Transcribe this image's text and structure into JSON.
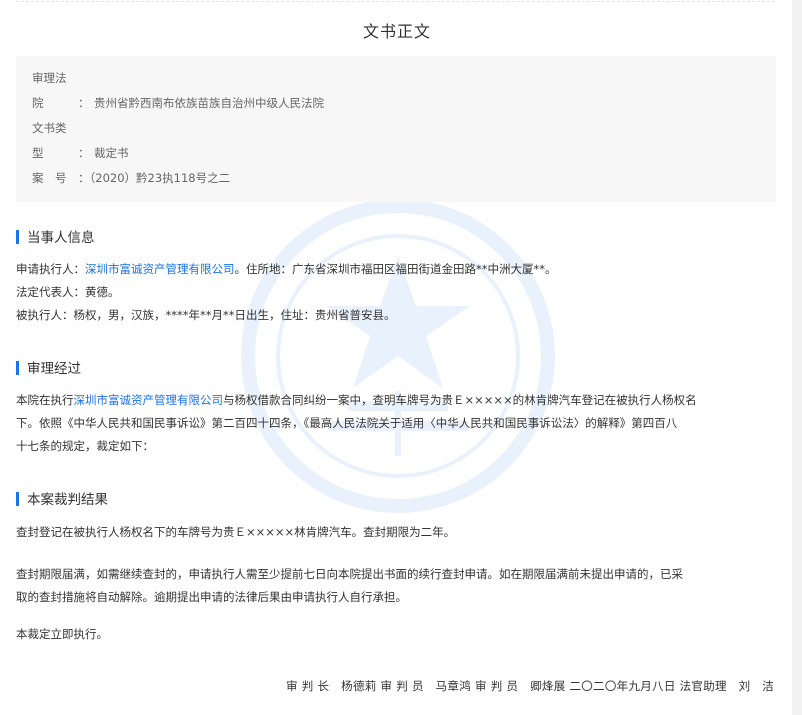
{
  "document": {
    "title": "文书正文"
  },
  "meta": {
    "court_label_line1": "审理法",
    "court_label_line2": "院",
    "court_value": "贵州省黔西南布依族苗族自治州中级人民法院",
    "doctype_label_line1": "文书类",
    "doctype_label_line2": "型",
    "doctype_value": "裁定书",
    "case_label": "案　号",
    "case_value": "（2020）黔23执118号之二",
    "colon": "：",
    "colon_short": "："
  },
  "parties": {
    "heading": "当事人信息",
    "applicant_prefix": "申请执行人：",
    "applicant_name": "深圳市富诚资产管理有限公司",
    "applicant_suffix": "。住所地：广东省深圳市福田区福田街道金田路**中洲大厦**。",
    "legal_rep": "法定代表人：黄德。",
    "respondent": "被执行人：杨权，男，汉族，****年**月**日出生，住址：贵州省普安县。"
  },
  "process": {
    "heading": "审理经过",
    "text_prefix": "本院在执行",
    "text_link": "深圳市富诚资产管理有限公司",
    "text_line1_rest": "与杨权借款合同纠纷一案中，查明车牌号为贵Ｅ×××××的林肯牌汽车登记在被执行人杨权名",
    "text_line2": "下。依照《中华人民共和国民事诉讼》第二百四十四条，《最高人民法院关于适用〈中华人民共和国民事诉讼法〉的解释》第四百八",
    "text_line3": "十七条的规定，裁定如下："
  },
  "result": {
    "heading": "本案裁判结果",
    "para1": "查封登记在被执行人杨权名下的车牌号为贵Ｅ×××××林肯牌汽车。查封期限为二年。",
    "para2_line1": "查封期限届满，如需继续查封的，申请执行人需至少提前七日向本院提出书面的续行查封申请。如在期限届满前未提出申请的，已采",
    "para2_line2": "取的查封措施将自动解除。逾期提出申请的法律后果由申请执行人自行承担。",
    "para3": "本裁定立即执行。"
  },
  "signature": {
    "text": "审 判 长　杨德莉 审 判 员　马章鸿 审 判 员　卿烽展 二〇二〇年九月八日 法官助理　刘　洁"
  },
  "colors": {
    "accent": "#1a73e8",
    "text": "#333333",
    "muted": "#666666",
    "meta_bg": "#f7f7f7"
  },
  "icons": {
    "watermark": "court-emblem-watermark",
    "section_marker": "section-bar-icon"
  }
}
